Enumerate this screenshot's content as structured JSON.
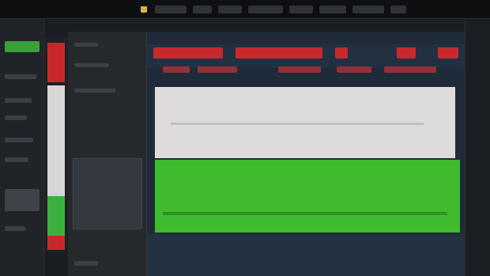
{
  "window": {
    "title": "",
    "menu": [
      "",
      "",
      "",
      "",
      "",
      "",
      "",
      ""
    ]
  },
  "left_panel": {
    "header": "",
    "items": [
      "",
      "",
      "",
      "",
      "",
      "",
      ""
    ]
  },
  "meter": {
    "colors": {
      "red": "#c9282b",
      "white": "#d8d6d4",
      "green": "#3cb03c"
    }
  },
  "middle_panel": {
    "lines": [
      "",
      "",
      ""
    ],
    "footer": ""
  },
  "main": {
    "toolbar_chips": [
      "",
      "",
      "",
      "",
      ""
    ],
    "toolbar_subtext": [
      "",
      "",
      "",
      "",
      ""
    ],
    "colors": {
      "accent": "#c8292e",
      "canvas_top": "#dedcda",
      "canvas_bottom": "#3fbb2d",
      "background": "#1f2b38"
    }
  }
}
